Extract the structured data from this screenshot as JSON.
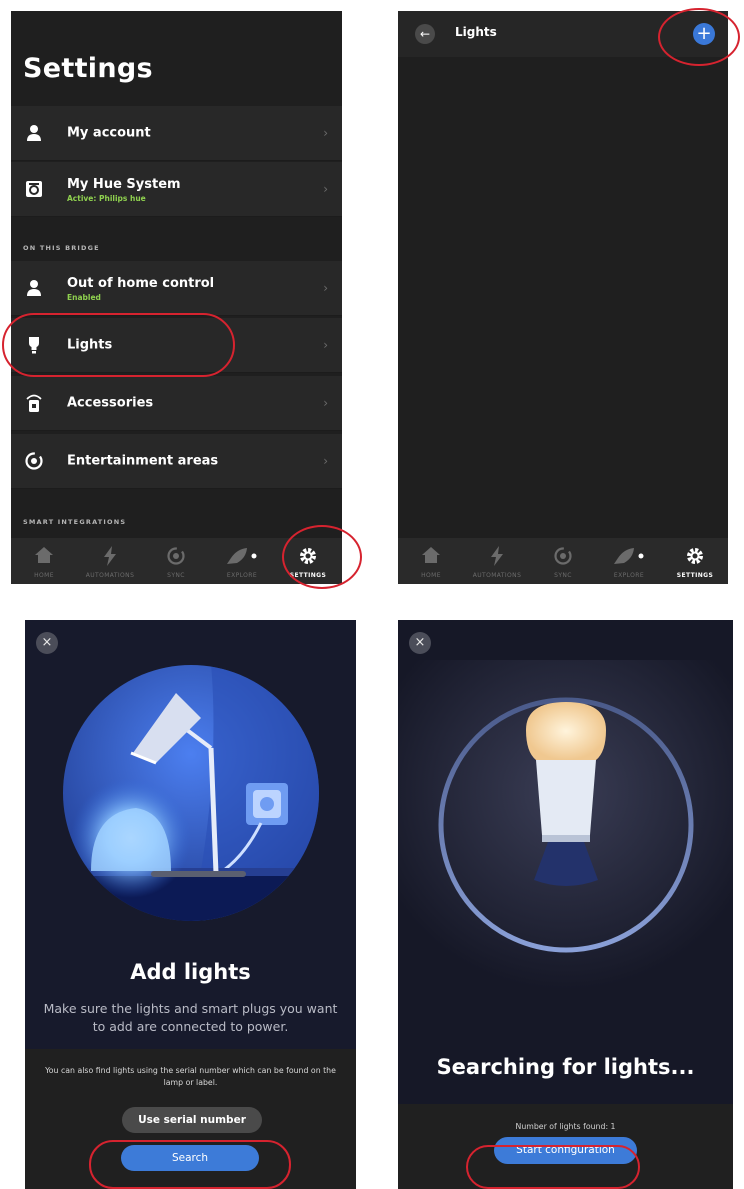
{
  "settings": {
    "title": "Settings",
    "rows_top": [
      {
        "label": "My account",
        "icon": "person-icon"
      },
      {
        "label": "My Hue System",
        "sub": "Active: Philips hue",
        "icon": "bridge-icon"
      }
    ],
    "section_bridge": "ON THIS BRIDGE",
    "rows_bridge": [
      {
        "label": "Out of home control",
        "sub": "Enabled",
        "icon": "person-icon"
      },
      {
        "label": "Lights",
        "icon": "bulb-icon"
      },
      {
        "label": "Accessories",
        "icon": "accessory-icon"
      },
      {
        "label": "Entertainment areas",
        "icon": "entertainment-icon"
      }
    ],
    "section_integrations": "SMART INTEGRATIONS",
    "chevron": "›"
  },
  "nav": {
    "items": [
      "HOME",
      "AUTOMATIONS",
      "SYNC",
      "EXPLORE",
      "SETTINGS"
    ],
    "active": "SETTINGS"
  },
  "lights": {
    "back": "←",
    "title": "Lights",
    "add": "+"
  },
  "add_lights": {
    "close": "×",
    "title": "Add lights",
    "description": "Make sure the lights and smart plugs you want to add are connected to power.",
    "serial_note": "You can also find lights using the serial number which can be found on the lamp or label.",
    "serial_button": "Use serial number",
    "search_button": "Search"
  },
  "searching": {
    "close": "×",
    "title": "Searching for lights...",
    "found_text": "Number of lights found: 1",
    "config_button": "Start configuration"
  },
  "colors": {
    "accent_blue": "#3d7bd8",
    "status_green": "#8fd14f",
    "highlight_red": "#d6232f"
  }
}
